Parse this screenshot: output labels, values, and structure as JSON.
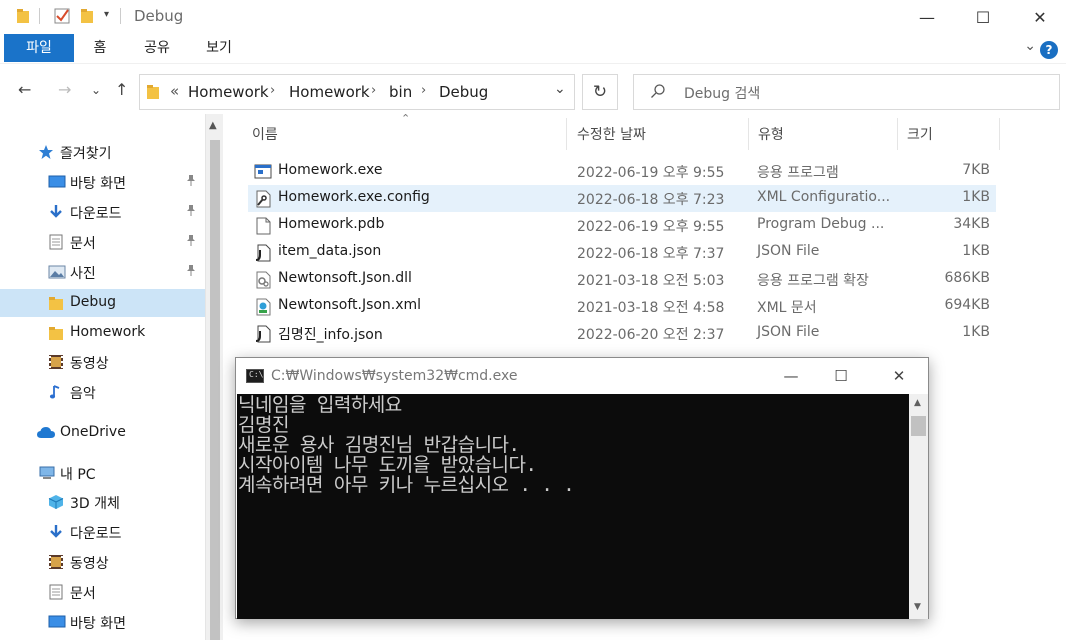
{
  "window": {
    "title": "Debug",
    "controls": {
      "minimize": "—",
      "maximize": "☐",
      "close": "✕"
    }
  },
  "ribbon": {
    "tabs": [
      "파일",
      "홈",
      "공유",
      "보기"
    ],
    "help": "?"
  },
  "address": {
    "prefix": "«",
    "crumbs": [
      "Homework",
      "Homework",
      "bin",
      "Debug"
    ]
  },
  "search": {
    "placeholder": "Debug 검색"
  },
  "sidebar": {
    "items": [
      {
        "label": "즐겨찾기",
        "icon": "star-icon"
      },
      {
        "label": "바탕 화면",
        "icon": "desktop-icon",
        "pinned": true
      },
      {
        "label": "다운로드",
        "icon": "download-icon",
        "pinned": true
      },
      {
        "label": "문서",
        "icon": "document-icon",
        "pinned": true
      },
      {
        "label": "사진",
        "icon": "pictures-icon",
        "pinned": true
      },
      {
        "label": "Debug",
        "icon": "folder-icon",
        "selected": true
      },
      {
        "label": "Homework",
        "icon": "folder-icon"
      },
      {
        "label": "동영상",
        "icon": "video-icon"
      },
      {
        "label": "음악",
        "icon": "music-icon"
      },
      {
        "label": "OneDrive",
        "icon": "cloud-icon"
      },
      {
        "label": "내 PC",
        "icon": "pc-icon"
      },
      {
        "label": "3D 개체",
        "icon": "cube-icon"
      },
      {
        "label": "다운로드",
        "icon": "download-icon"
      },
      {
        "label": "동영상",
        "icon": "video-icon"
      },
      {
        "label": "문서",
        "icon": "document-icon"
      },
      {
        "label": "바탕 화면",
        "icon": "desktop-icon"
      }
    ]
  },
  "columns": {
    "name": "이름",
    "date": "수정한 날짜",
    "type": "유형",
    "size": "크기"
  },
  "files": [
    {
      "name": "Homework.exe",
      "date": "2022-06-19 오후 9:55",
      "type": "응용 프로그램",
      "size": "7KB",
      "icon": "exe-icon"
    },
    {
      "name": "Homework.exe.config",
      "date": "2022-06-18 오후 7:23",
      "type": "XML Configuratio...",
      "size": "1KB",
      "icon": "config-file-icon",
      "selected": true
    },
    {
      "name": "Homework.pdb",
      "date": "2022-06-19 오후 9:55",
      "type": "Program Debug ...",
      "size": "34KB",
      "icon": "file-icon"
    },
    {
      "name": "item_data.json",
      "date": "2022-06-18 오후 7:37",
      "type": "JSON File",
      "size": "1KB",
      "icon": "json-file-icon"
    },
    {
      "name": "Newtonsoft.Json.dll",
      "date": "2021-03-18 오전 5:03",
      "type": "응용 프로그램 확장",
      "size": "686KB",
      "icon": "dll-icon"
    },
    {
      "name": "Newtonsoft.Json.xml",
      "date": "2021-03-18 오전 4:58",
      "type": "XML 문서",
      "size": "694KB",
      "icon": "xml-file-icon"
    },
    {
      "name": "김명진_info.json",
      "date": "2022-06-20 오전 2:37",
      "type": "JSON File",
      "size": "1KB",
      "icon": "json-file-icon"
    }
  ],
  "cmd": {
    "title": "C:₩Windows₩system32₩cmd.exe",
    "lines": [
      "닉네임을 입력하세요",
      "김명진",
      "새로운 용사 김명진님 반갑습니다.",
      "시작아이템 나무 도끼을 받았습니다.",
      "계속하려면 아무 키나 누르십시오 . . ."
    ]
  }
}
